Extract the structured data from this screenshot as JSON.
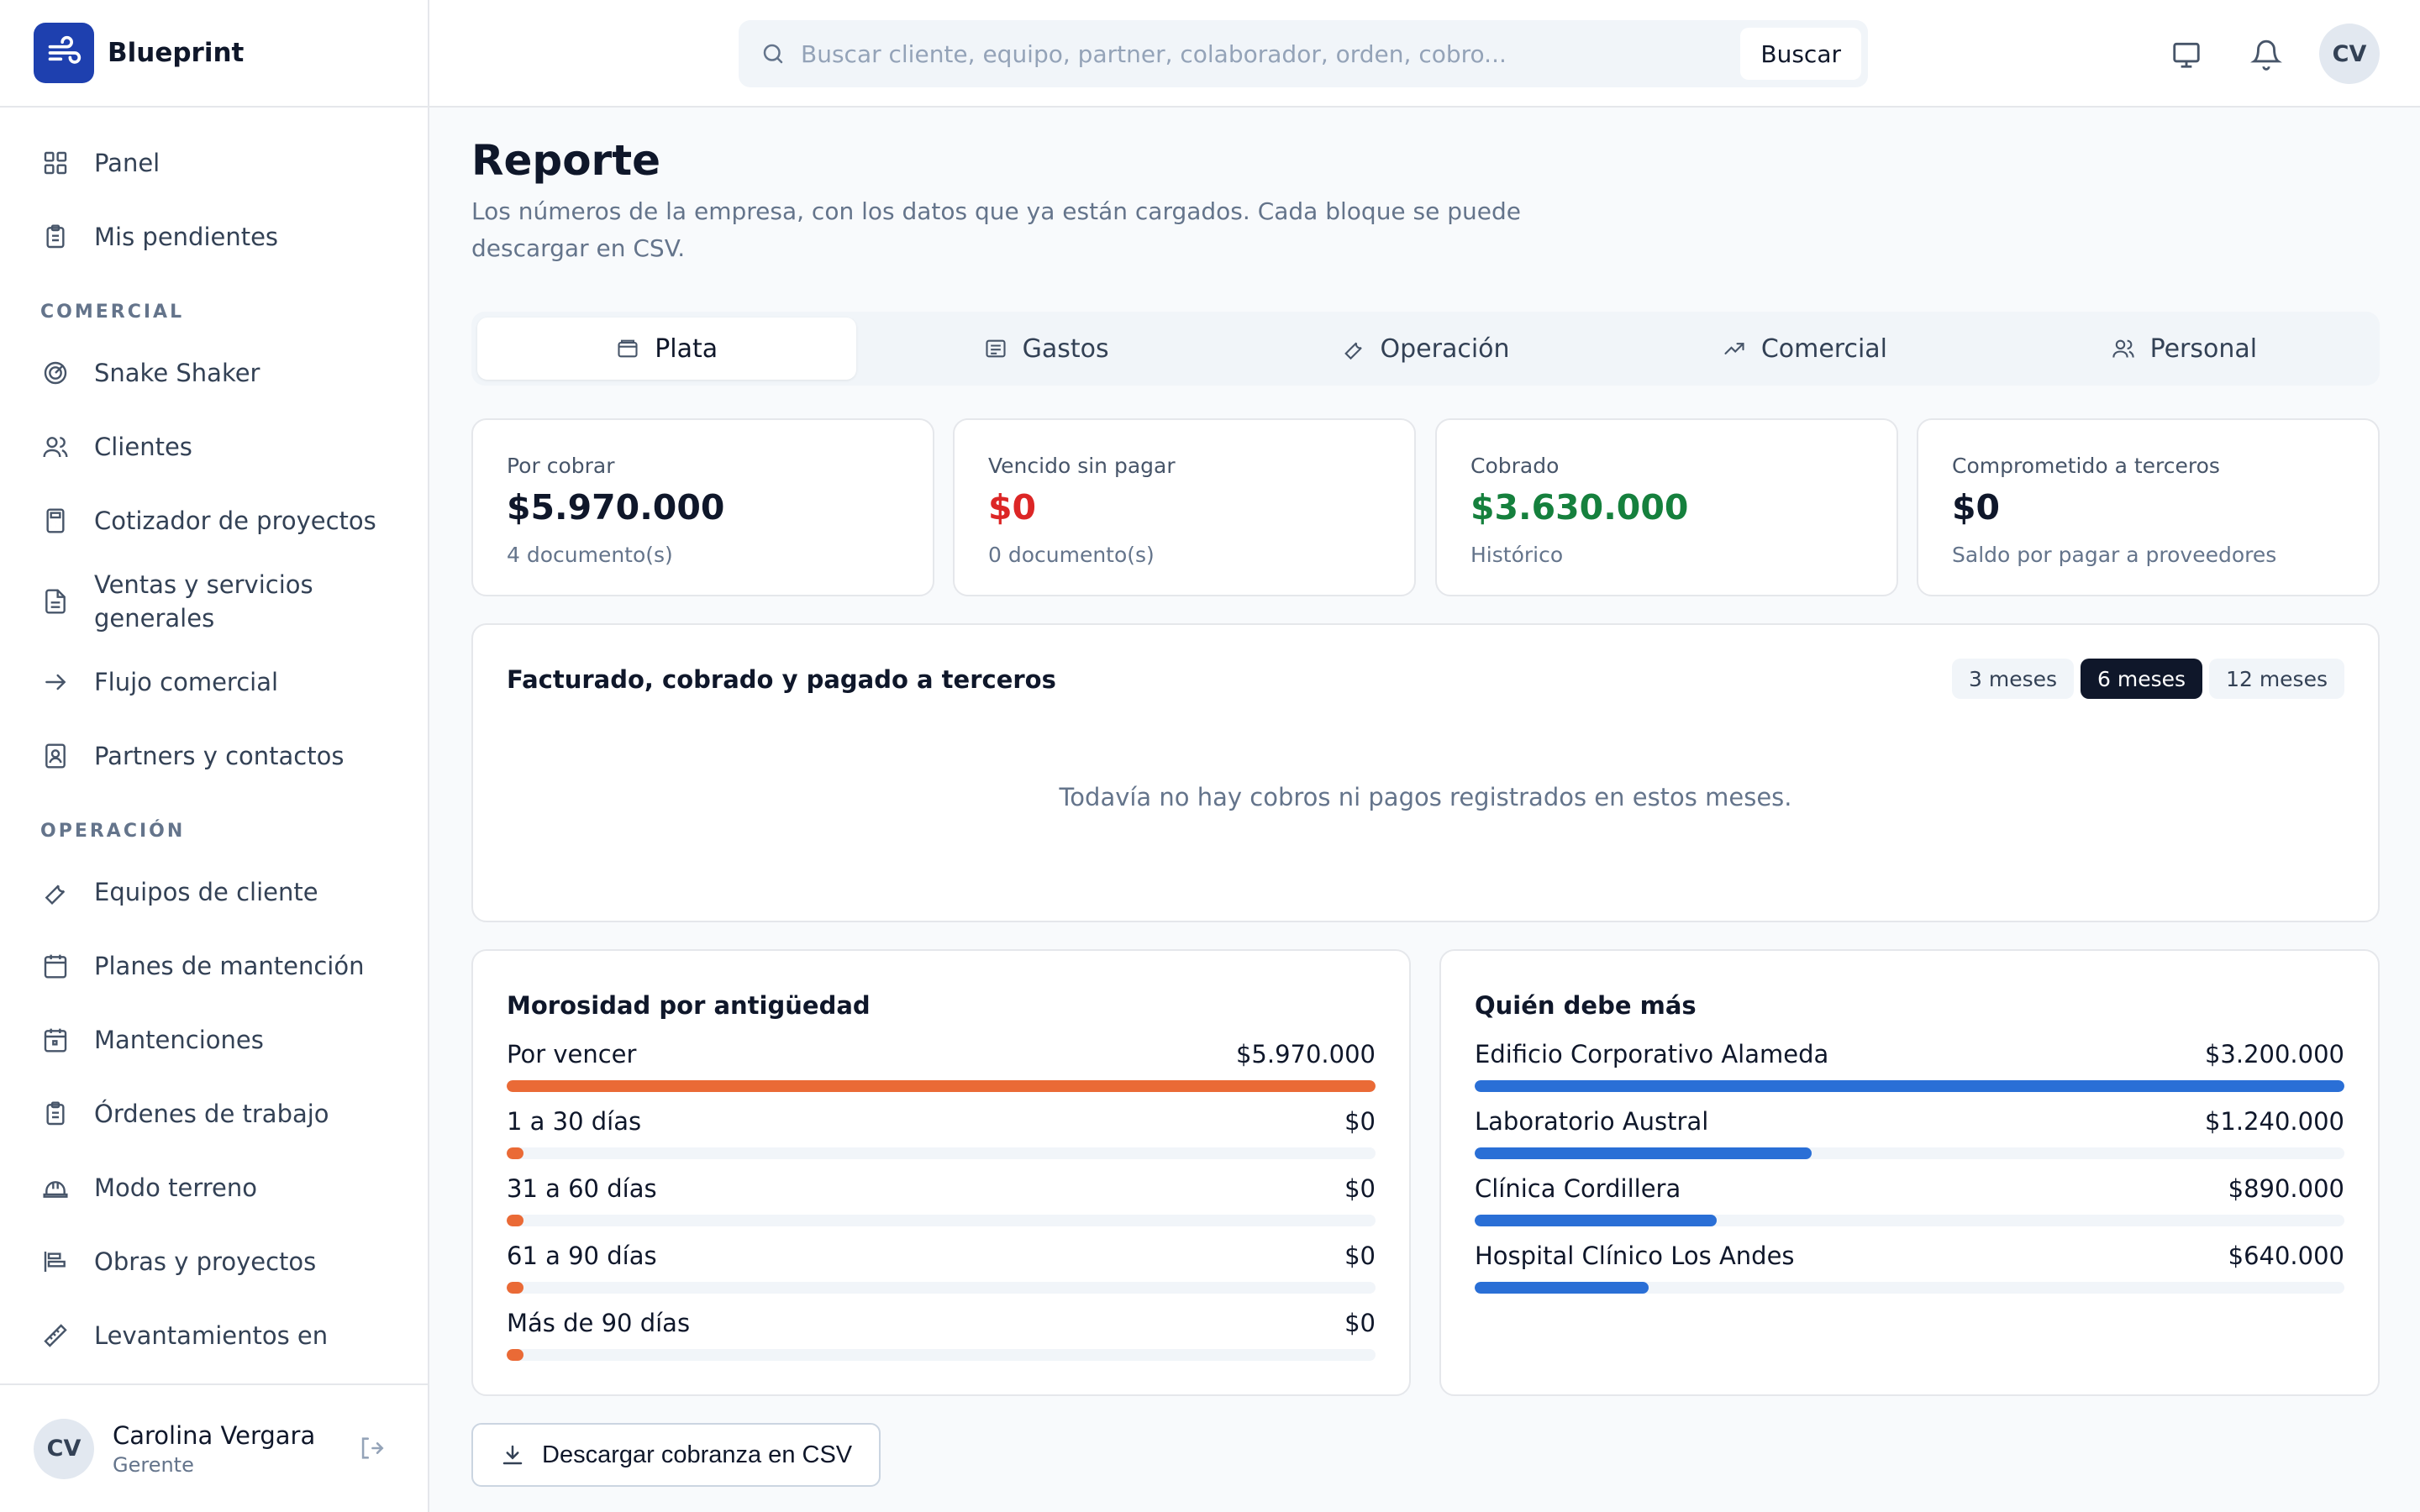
{
  "app": {
    "name": "Blueprint"
  },
  "search": {
    "placeholder": "Buscar cliente, equipo, partner, colaborador, orden, cobro...",
    "button": "Buscar"
  },
  "header": {
    "avatar_initials": "CV"
  },
  "sidebar": {
    "items_top": [
      {
        "label": "Panel",
        "icon": "grid-icon"
      },
      {
        "label": "Mis pendientes",
        "icon": "clipboard-icon"
      }
    ],
    "section_comercial": "COMERCIAL",
    "items_comercial": [
      {
        "label": "Snake Shaker",
        "icon": "target-icon"
      },
      {
        "label": "Clientes",
        "icon": "users-icon"
      },
      {
        "label": "Cotizador de proyectos",
        "icon": "calculator-icon"
      },
      {
        "label": "Ventas y servicios generales",
        "icon": "document-icon"
      },
      {
        "label": "Flujo comercial",
        "icon": "arrow-right-icon"
      },
      {
        "label": "Partners y contactos",
        "icon": "contact-icon"
      }
    ],
    "section_operacion": "OPERACIÓN",
    "items_operacion": [
      {
        "label": "Equipos de cliente",
        "icon": "wrench-icon"
      },
      {
        "label": "Planes de mantención",
        "icon": "calendar-grid-icon"
      },
      {
        "label": "Mantenciones",
        "icon": "calendar-icon"
      },
      {
        "label": "Órdenes de trabajo",
        "icon": "clipboard-icon"
      },
      {
        "label": "Modo terreno",
        "icon": "hardhat-icon"
      },
      {
        "label": "Obras y proyectos",
        "icon": "gantt-icon"
      },
      {
        "label": "Levantamientos en",
        "icon": "ruler-icon"
      }
    ],
    "user": {
      "initials": "CV",
      "name": "Carolina Vergara",
      "role": "Gerente"
    }
  },
  "page": {
    "title": "Reporte",
    "subtitle": "Los números de la empresa, con los datos que ya están cargados. Cada bloque se puede descargar en CSV."
  },
  "tabs": [
    {
      "label": "Plata",
      "icon": "wallet-icon",
      "active": true
    },
    {
      "label": "Gastos",
      "icon": "receipt-icon",
      "active": false
    },
    {
      "label": "Operación",
      "icon": "wrench-icon",
      "active": false
    },
    {
      "label": "Comercial",
      "icon": "trending-up-icon",
      "active": false
    },
    {
      "label": "Personal",
      "icon": "users-icon",
      "active": false
    }
  ],
  "stats": [
    {
      "label": "Por cobrar",
      "value": "$5.970.000",
      "sub": "4 documento(s)",
      "color": "#0f172a"
    },
    {
      "label": "Vencido sin pagar",
      "value": "$0",
      "sub": "0 documento(s)",
      "color": "#dc2626"
    },
    {
      "label": "Cobrado",
      "value": "$3.630.000",
      "sub": "Histórico",
      "color": "#15803d"
    },
    {
      "label": "Comprometido a terceros",
      "value": "$0",
      "sub": "Saldo por pagar a proveedores",
      "color": "#0f172a"
    }
  ],
  "flow_card": {
    "title": "Facturado, cobrado y pagado a terceros",
    "ranges": [
      "3 meses",
      "6 meses",
      "12 meses"
    ],
    "active_range": "6 meses",
    "empty_message": "Todavía no hay cobros ni pagos registrados en estos meses."
  },
  "aging": {
    "title": "Morosidad por antigüedad",
    "color": "#ea6a36",
    "rows": [
      {
        "label": "Por vencer",
        "value": "$5.970.000",
        "amount": 5970000
      },
      {
        "label": "1 a 30 días",
        "value": "$0",
        "amount": 0
      },
      {
        "label": "31 a 60 días",
        "value": "$0",
        "amount": 0
      },
      {
        "label": "61 a 90 días",
        "value": "$0",
        "amount": 0
      },
      {
        "label": "Más de 90 días",
        "value": "$0",
        "amount": 0
      }
    ]
  },
  "debtors": {
    "title": "Quién debe más",
    "color": "#2a6fd6",
    "rows": [
      {
        "label": "Edificio Corporativo Alameda",
        "value": "$3.200.000",
        "amount": 3200000
      },
      {
        "label": "Laboratorio Austral",
        "value": "$1.240.000",
        "amount": 1240000
      },
      {
        "label": "Clínica Cordillera",
        "value": "$890.000",
        "amount": 890000
      },
      {
        "label": "Hospital Clínico Los Andes",
        "value": "$640.000",
        "amount": 640000
      }
    ]
  },
  "download": {
    "label": "Descargar cobranza en CSV"
  }
}
